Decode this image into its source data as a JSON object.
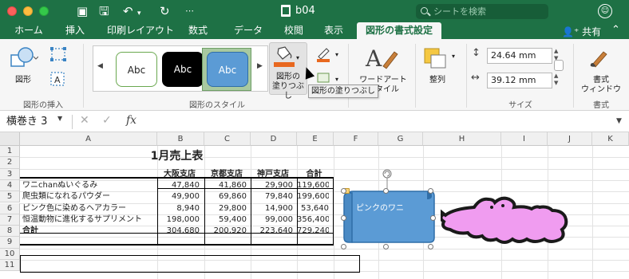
{
  "window": {
    "title": "b04",
    "search_placeholder": "シートを検索"
  },
  "tabs": [
    {
      "label": "ホーム"
    },
    {
      "label": "挿入"
    },
    {
      "label": "印刷レイアウト"
    },
    {
      "label": "数式"
    },
    {
      "label": "データ"
    },
    {
      "label": "校閲"
    },
    {
      "label": "表示"
    },
    {
      "label": "図形の書式設定",
      "active": true
    }
  ],
  "share_label": "共有",
  "ribbon": {
    "insert_shape": {
      "shape_label": "図形",
      "group_label": "図形の挿入"
    },
    "shape_styles": {
      "style_labels": [
        "Abc",
        "Abc",
        "Abc"
      ],
      "fill_label_line1": "図形の",
      "fill_label_line2": "塗りつぶし",
      "group_label": "図形のスタイル",
      "tooltip": "図形の塗りつぶし"
    },
    "wordart": {
      "label_line1": "ワードアート",
      "label_line2": "スタイル"
    },
    "arrange": {
      "label": "整列"
    },
    "size": {
      "height": "24.64 mm",
      "width": "39.12 mm",
      "group_label": "サイズ"
    },
    "format_pane": {
      "label_line1": "書式",
      "label_line2": "ウィンドウ",
      "group_label": "書式"
    }
  },
  "formula_bar": {
    "name_box": "横巻き 3",
    "fx": "fx"
  },
  "columns": [
    "A",
    "B",
    "C",
    "D",
    "E",
    "F",
    "G",
    "H",
    "I",
    "J",
    "K"
  ],
  "rows": [
    "1",
    "2",
    "3",
    "4",
    "5",
    "6",
    "7",
    "8",
    "9",
    "10",
    "11"
  ],
  "sheet": {
    "title": "1月売上表",
    "headers": [
      "大阪支店",
      "京都支店",
      "神戸支店",
      "合計"
    ],
    "data_rows": [
      {
        "name": "ワニchanぬいぐるみ",
        "values": [
          "47,840",
          "41,860",
          "29,900",
          "119,600"
        ]
      },
      {
        "name": "爬虫類になれるパウダー",
        "values": [
          "49,900",
          "69,860",
          "79,840",
          "199,600"
        ]
      },
      {
        "name": "ピンク色に染めるヘアカラー",
        "values": [
          "8,940",
          "29,800",
          "14,900",
          "53,640"
        ]
      },
      {
        "name": "恒温動物に進化するサプリメント",
        "values": [
          "198,000",
          "59,400",
          "99,000",
          "356,400"
        ]
      },
      {
        "name": "合計",
        "values": [
          "304,680",
          "200,920",
          "223,640",
          "729,240"
        ]
      }
    ]
  },
  "shapes": {
    "scroll_text": "ピンクのワニ",
    "scroll_fill": "#5b9bd5",
    "croc_fill": "#f09cf0"
  },
  "colors": {
    "accent": "#1e7145",
    "orange": "#e8681f"
  }
}
